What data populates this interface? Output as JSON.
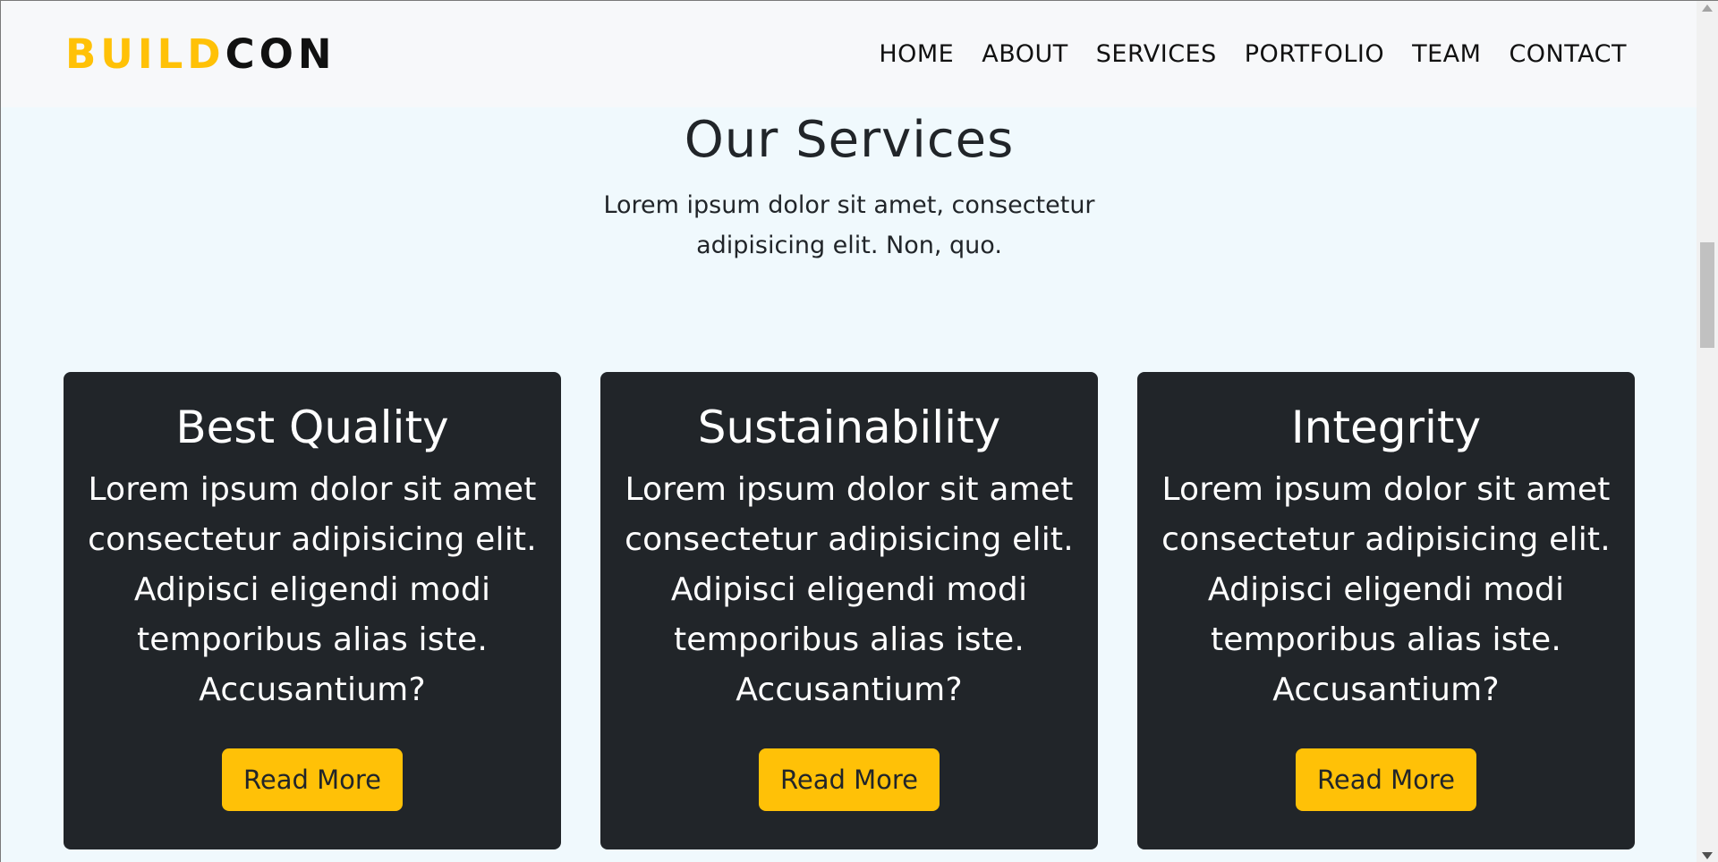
{
  "brand": {
    "part1": "BUILD",
    "part2": "CON"
  },
  "nav": {
    "items": [
      "HOME",
      "ABOUT",
      "SERVICES",
      "PORTFOLIO",
      "TEAM",
      "CONTACT"
    ]
  },
  "services": {
    "title": "Our Services",
    "subtitle": "Lorem ipsum dolor sit amet, consectetur adipisicing elit. Non, quo.",
    "cards": [
      {
        "title": "Best Quality",
        "text": "Lorem ipsum dolor sit amet consectetur adipisicing elit. Adipisci eligendi modi temporibus alias iste. Accusantium?",
        "button": "Read More"
      },
      {
        "title": "Sustainability",
        "text": "Lorem ipsum dolor sit amet consectetur adipisicing elit. Adipisci eligendi modi temporibus alias iste. Accusantium?",
        "button": "Read More"
      },
      {
        "title": "Integrity",
        "text": "Lorem ipsum dolor sit amet consectetur adipisicing elit. Adipisci eligendi modi temporibus alias iste. Accusantium?",
        "button": "Read More"
      }
    ]
  },
  "colors": {
    "accent": "#ffc107",
    "card_bg": "#212529",
    "page_bg": "#f0f9fd",
    "nav_bg": "#f7f8fa"
  }
}
